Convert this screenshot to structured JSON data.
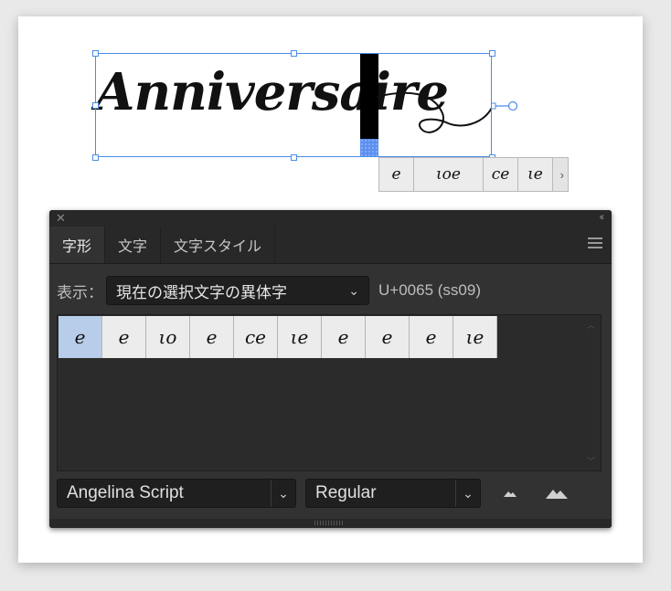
{
  "artboard": {
    "text": "Anniversaire"
  },
  "context_alternates": {
    "glyphs": [
      "e",
      "ιοe",
      "ce",
      "ιe"
    ],
    "more_icon": "chevron-right-icon"
  },
  "panel": {
    "tabs": [
      {
        "label": "字形",
        "active": true
      },
      {
        "label": "文字",
        "active": false
      },
      {
        "label": "文字スタイル",
        "active": false
      }
    ],
    "show_label": "表示：",
    "show_value": "現在の選択文字の異体字",
    "unicode": "U+0065 (ss09)",
    "glyphs": [
      "e",
      "e",
      "ιο",
      "e",
      "ce",
      "ιe",
      "e",
      "e",
      "e",
      "ιe"
    ],
    "selected_glyph_index": 0,
    "font_family": "Angelina Script",
    "font_style": "Regular",
    "colors": {
      "panel_bg": "#323232",
      "selection": "#4a8ce8",
      "cell_selected": "#b8cde9"
    }
  }
}
